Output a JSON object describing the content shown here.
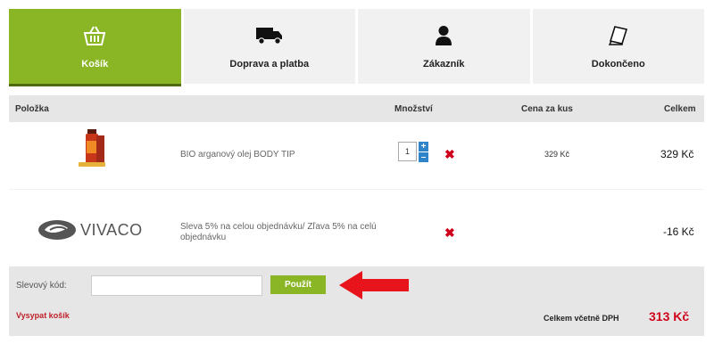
{
  "steps": [
    {
      "label": "Košík",
      "icon": "basket-icon"
    },
    {
      "label": "Doprava a platba",
      "icon": "truck-icon"
    },
    {
      "label": "Zákazník",
      "icon": "user-icon"
    },
    {
      "label": "Dokončeno",
      "icon": "document-icon"
    }
  ],
  "table": {
    "headers": {
      "item": "Položka",
      "qty": "Množství",
      "unit_price": "Cena za kus",
      "total": "Celkem"
    },
    "rows": [
      {
        "name": "BIO arganový olej BODY TIP",
        "qty": "1",
        "unit_price": "329 Kč",
        "total": "329 Kč"
      },
      {
        "name": "Sleva 5% na celou objednávku/ Zľava 5% na celú objednávku",
        "logo": "VIVACO",
        "total": "-16 Kč"
      }
    ]
  },
  "coupon": {
    "label": "Slevový kód:",
    "value": "",
    "apply": "Použít"
  },
  "cart": {
    "empty_label": "Vysypat košík",
    "total_label": "Celkem včetně DPH",
    "total_value": "313 Kč"
  },
  "colors": {
    "accent": "#8ab626",
    "price_red": "#d0021b",
    "arrow": "#e8141c"
  }
}
